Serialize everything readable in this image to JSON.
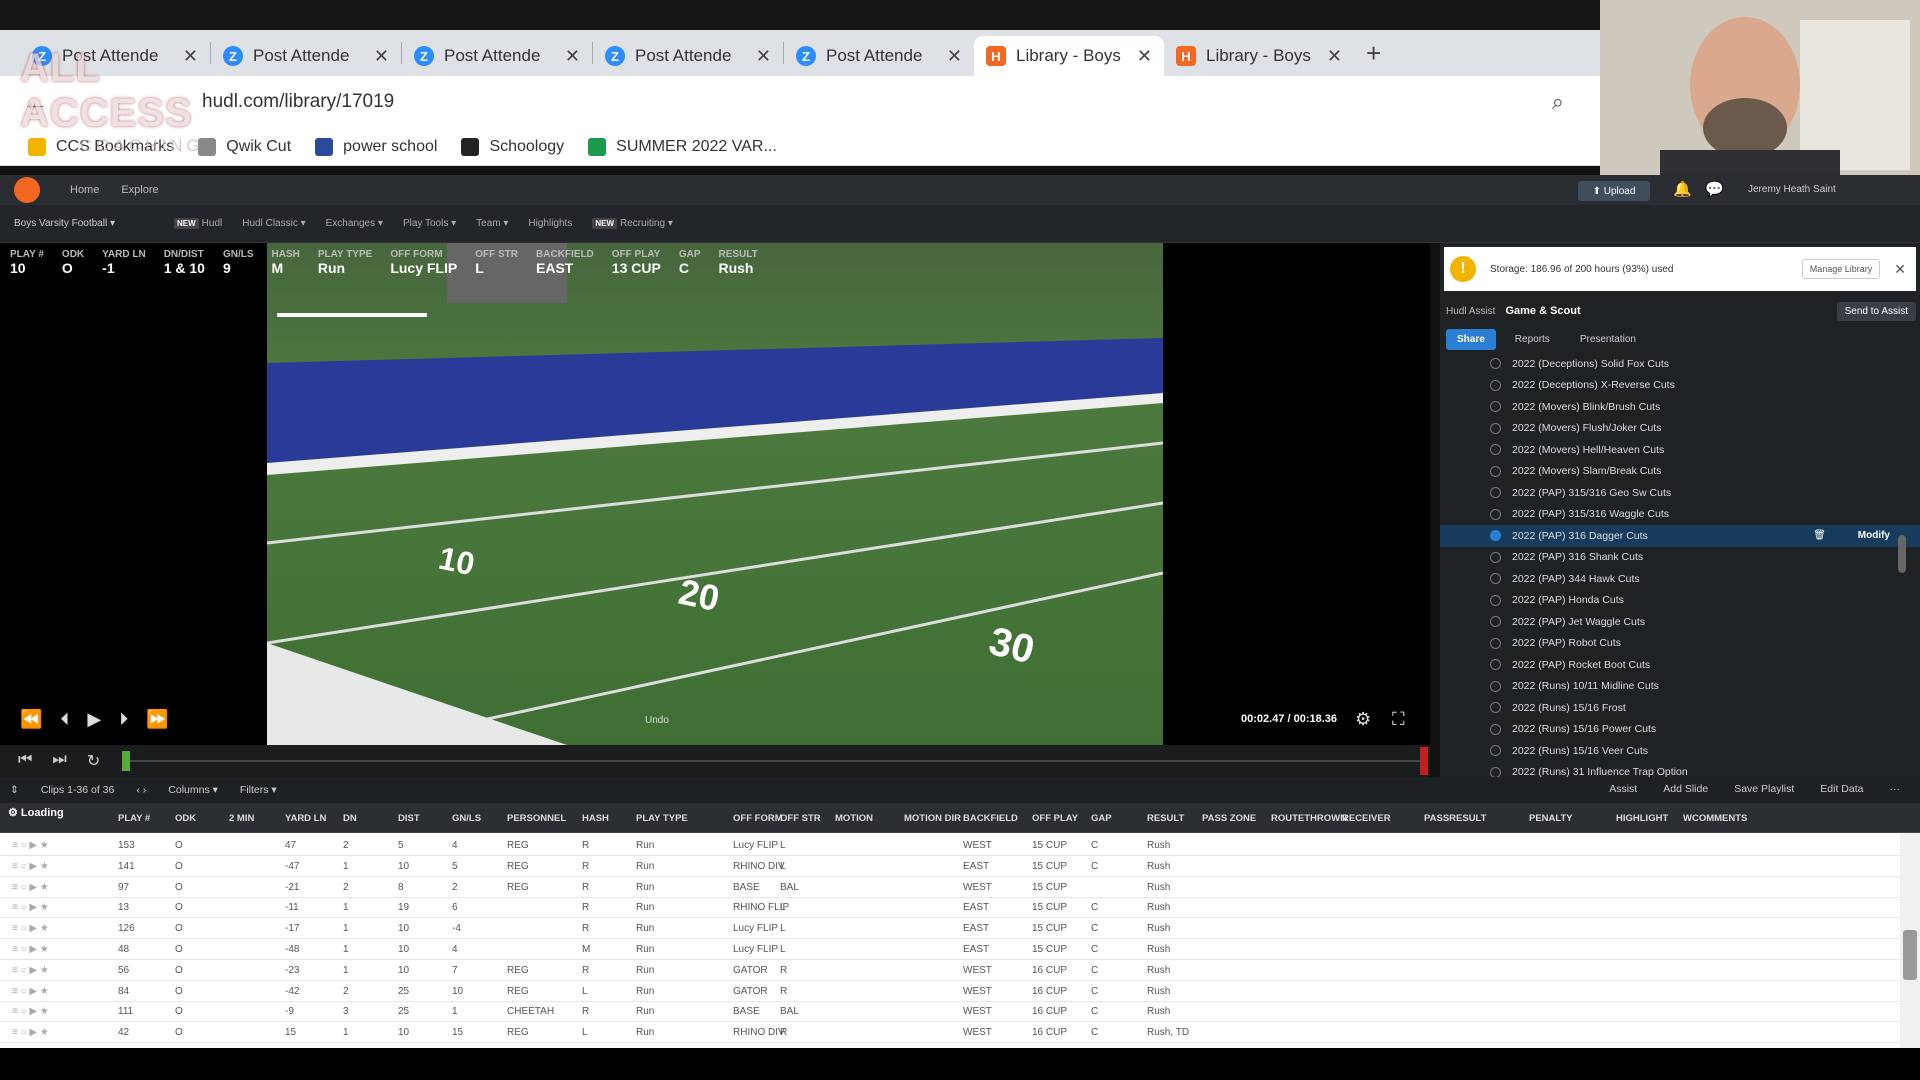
{
  "browser": {
    "tabs": [
      {
        "label": "Post Attende",
        "icon": "Z"
      },
      {
        "label": "Post Attende",
        "icon": "Z"
      },
      {
        "label": "Post Attende",
        "icon": "Z"
      },
      {
        "label": "Post Attende",
        "icon": "Z"
      },
      {
        "label": "Post Attende",
        "icon": "Z"
      },
      {
        "label": "Library - Boys",
        "icon": "H",
        "active": true
      },
      {
        "label": "Library - Boys",
        "icon": "H"
      }
    ],
    "new_tab": "+",
    "close": "✕",
    "url": "hudl.com/library/17019",
    "bookmarks": [
      "CCS Bookmarks",
      "Qwik Cut",
      "power school",
      "Schoology",
      "SUMMER 2022 VAR..."
    ],
    "overlay_line1": "ALL ACCESS",
    "overlay_line2": "COACHING"
  },
  "hudl_nav": {
    "links": [
      "Home",
      "Explore"
    ],
    "upload": "Upload",
    "user": "Jeremy Heath Saint"
  },
  "subnav": {
    "team": "Boys Varsity Football",
    "items": [
      "Hudl",
      "Hudl Classic",
      "Exchanges",
      "Play Tools",
      "Team",
      "Highlights",
      "Recruiting"
    ],
    "new_badge": "NEW"
  },
  "play_info": [
    {
      "k": "PLAY #",
      "v": "10"
    },
    {
      "k": "ODK",
      "v": "O"
    },
    {
      "k": "YARD LN",
      "v": "-1"
    },
    {
      "k": "DN/DIST",
      "v": "1 & 10"
    },
    {
      "k": "GN/LS",
      "v": "9"
    },
    {
      "k": "HASH",
      "v": "M"
    },
    {
      "k": "PLAY TYPE",
      "v": "Run"
    },
    {
      "k": "OFF FORM",
      "v": "Lucy FLIP"
    },
    {
      "k": "OFF STR",
      "v": "L"
    },
    {
      "k": "BACKFIELD",
      "v": "EAST"
    },
    {
      "k": "OFF PLAY",
      "v": "13 CUP"
    },
    {
      "k": "GAP",
      "v": "C"
    },
    {
      "k": "RESULT",
      "v": "Rush"
    }
  ],
  "video": {
    "timecode": "00:02.47 / 00:18.36",
    "field_numbers": [
      "10",
      "20",
      "30"
    ],
    "undo": "Undo"
  },
  "panel": {
    "storage": "Storage: 186.96 of 200 hours (93%) used",
    "manage": "Manage Library",
    "assist_label": "Hudl Assist",
    "assist_title": "Game & Scout",
    "send": "Send to Assist",
    "tabs": [
      "Share",
      "Reports",
      "Presentation"
    ],
    "playlists": [
      "2022 (Deceptions) Solid Fox Cuts",
      "2022 (Deceptions) X-Reverse Cuts",
      "2022 (Movers) Blink/Brush Cuts",
      "2022 (Movers) Flush/Joker Cuts",
      "2022 (Movers) Hell/Heaven Cuts",
      "2022 (Movers) Slam/Break Cuts",
      "2022 (PAP) 315/316 Geo Sw Cuts",
      "2022 (PAP) 315/316 Waggle Cuts",
      "2022 (PAP) 316 Dagger Cuts",
      "2022 (PAP) 316 Shank Cuts",
      "2022 (PAP) 344 Hawk Cuts",
      "2022 (PAP) Honda Cuts",
      "2022 (PAP) Jet Waggle Cuts",
      "2022 (PAP) Robot Cuts",
      "2022 (PAP) Rocket Boot Cuts",
      "2022 (Runs) 10/11 Midline Cuts",
      "2022 (Runs) 15/16 Frost",
      "2022 (Runs) 15/16 Power Cuts",
      "2022 (Runs) 15/16 Veer Cuts",
      "2022 (Runs) 31 Influence Trap Option"
    ],
    "modify": "Modify"
  },
  "grid": {
    "clips": "Clips 1-36 of 36",
    "columns": "Columns",
    "filters": "Filters",
    "right_actions": [
      "Assist",
      "Add Slide",
      "Save Playlist",
      "Edit Data",
      "···"
    ],
    "loading": "Loading",
    "headers": [
      "PLAY #",
      "ODK",
      "2 MIN",
      "YARD LN",
      "DN",
      "DIST",
      "GN/LS",
      "PERSONNEL",
      "HASH",
      "PLAY TYPE",
      "OFF FORM",
      "OFF STR",
      "MOTION",
      "MOTION DIR",
      "BACKFIELD",
      "OFF PLAY",
      "GAP",
      "RESULT",
      "PASS ZONE",
      "ROUTETHROWN",
      "RECEIVER",
      "PASSRESULT",
      "PENALTY",
      "HIGHLIGHT",
      "WCOMMENTS"
    ],
    "rows": [
      [
        "153",
        "O",
        "",
        "47",
        "2",
        "5",
        "4",
        "REG",
        "R",
        "Run",
        "Lucy FLIP",
        "L",
        "",
        "",
        "WEST",
        "15 CUP",
        "C",
        "Rush"
      ],
      [
        "141",
        "O",
        "",
        "-47",
        "1",
        "10",
        "5",
        "REG",
        "R",
        "Run",
        "RHINO DIV",
        "L",
        "",
        "",
        "EAST",
        "15 CUP",
        "C",
        "Rush"
      ],
      [
        "97",
        "O",
        "",
        "-21",
        "2",
        "8",
        "2",
        "REG",
        "R",
        "Run",
        "BASE",
        "BAL",
        "",
        "",
        "WEST",
        "15 CUP",
        "",
        "Rush"
      ],
      [
        "13",
        "O",
        "",
        "-11",
        "1",
        "19",
        "6",
        "",
        "R",
        "Run",
        "RHINO FLIP",
        "L",
        "",
        "",
        "EAST",
        "15 CUP",
        "C",
        "Rush"
      ],
      [
        "126",
        "O",
        "",
        "-17",
        "1",
        "10",
        "-4",
        "",
        "R",
        "Run",
        "Lucy FLIP",
        "L",
        "",
        "",
        "EAST",
        "15 CUP",
        "C",
        "Rush"
      ],
      [
        "48",
        "O",
        "",
        "-48",
        "1",
        "10",
        "4",
        "",
        "M",
        "Run",
        "Lucy FLIP",
        "L",
        "",
        "",
        "EAST",
        "15 CUP",
        "C",
        "Rush"
      ],
      [
        "56",
        "O",
        "",
        "-23",
        "1",
        "10",
        "7",
        "REG",
        "R",
        "Run",
        "GATOR",
        "R",
        "",
        "",
        "WEST",
        "16 CUP",
        "C",
        "Rush"
      ],
      [
        "84",
        "O",
        "",
        "-42",
        "2",
        "25",
        "10",
        "REG",
        "L",
        "Run",
        "GATOR",
        "R",
        "",
        "",
        "WEST",
        "16 CUP",
        "C",
        "Rush"
      ],
      [
        "111",
        "O",
        "",
        "-9",
        "3",
        "25",
        "1",
        "CHEETAH",
        "R",
        "Run",
        "BASE",
        "BAL",
        "",
        "",
        "WEST",
        "16 CUP",
        "C",
        "Rush"
      ],
      [
        "42",
        "O",
        "",
        "15",
        "1",
        "10",
        "15",
        "REG",
        "L",
        "Run",
        "RHINO DIV",
        "R",
        "",
        "",
        "WEST",
        "16 CUP",
        "C",
        "Rush, TD"
      ]
    ]
  }
}
